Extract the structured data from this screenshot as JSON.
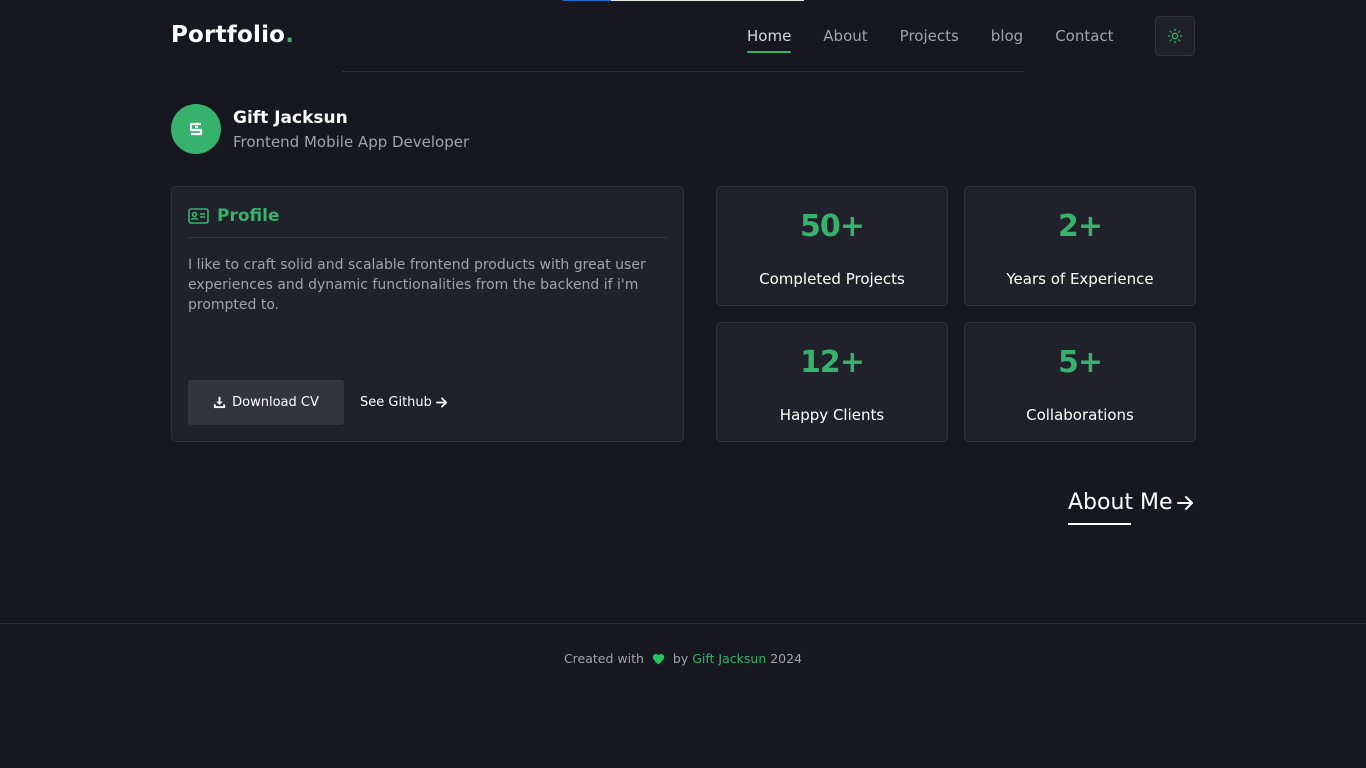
{
  "top_progress": {
    "fraction": 0.2
  },
  "header": {
    "brand": "Portfolio",
    "brand_dot": ".",
    "nav": [
      {
        "label": "Home",
        "active": true
      },
      {
        "label": "About"
      },
      {
        "label": "Projects"
      },
      {
        "label": "blog"
      },
      {
        "label": "Contact"
      }
    ],
    "theme_toggle_icon": "sun-icon"
  },
  "intro": {
    "name": "Gift Jacksun",
    "role": "Frontend Mobile App Developer",
    "avatar_icon": "logo-g-icon"
  },
  "profile": {
    "icon": "id-card-icon",
    "title": "Profile",
    "text": "I like to craft solid and scalable frontend products with great user experiences and dynamic functionalities from the backend if i'm prompted to.",
    "download_label": "Download CV",
    "download_icon": "download-icon",
    "github_label": "See Github",
    "github_icon": "arrow-right-icon"
  },
  "stats": [
    {
      "value": "50+",
      "label": "Completed Projects"
    },
    {
      "value": "2+",
      "label": "Years of Experience"
    },
    {
      "value": "12+",
      "label": "Happy Clients"
    },
    {
      "value": "5+",
      "label": "Collaborations"
    }
  ],
  "about_link": {
    "label": "About Me",
    "icon": "arrow-right-icon"
  },
  "footer": {
    "prefix": "Created with",
    "heart_icon": "heart-icon",
    "by": "by",
    "author": "Gift Jacksun",
    "year": "2024"
  },
  "colors": {
    "background": "#17171f",
    "card": "#21212b",
    "accent": "#37b26c",
    "heart": "#22c55e",
    "progress": "#1f6fd1"
  }
}
